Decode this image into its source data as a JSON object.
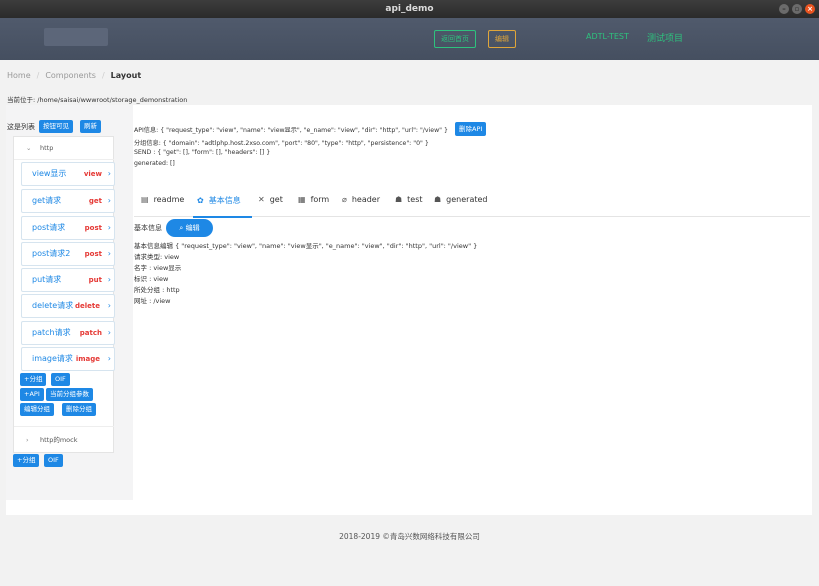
{
  "window": {
    "title": "api_demo",
    "controls": [
      "minimize-icon",
      "maximize-icon",
      "close-icon"
    ]
  },
  "header": {
    "home_button": "返回首页",
    "edit_button": "编辑",
    "links": [
      "ADTL-TEST",
      "测试项目"
    ]
  },
  "breadcrumb": [
    "Home",
    "Components",
    "Layout"
  ],
  "current_path": "当前位于: /home/saisai/wwwroot/storage_demonstration",
  "list": {
    "label": "这是列表",
    "toggle_button": "按钮可见",
    "refresh_button": "刷新"
  },
  "groups": [
    {
      "name": "http",
      "expanded": true,
      "apis": [
        {
          "name": "view显示",
          "method": "view"
        },
        {
          "name": "get请求",
          "method": "get"
        },
        {
          "name": "post请求",
          "method": "post"
        },
        {
          "name": "post请求2",
          "method": "post"
        },
        {
          "name": "put请求",
          "method": "put"
        },
        {
          "name": "delete请求",
          "method": "delete"
        },
        {
          "name": "patch请求",
          "method": "patch"
        },
        {
          "name": "image请求",
          "method": "image"
        }
      ],
      "actions": [
        "+分组",
        "OIF",
        "+API",
        "当前分组参数",
        "编辑分组",
        "删除分组"
      ]
    },
    {
      "name": "http的mock",
      "expanded": false
    }
  ],
  "bottom_actions": [
    "+分组",
    "OIF"
  ],
  "api_info": {
    "api_line": "API信息: { \"request_type\": \"view\", \"name\": \"view显示\", \"e_name\": \"view\", \"dir\": \"http\", \"url\": \"/view\" }",
    "delete_api_button": "删除API",
    "group_line": "分组信息: { \"domain\": \"adtlphp.host.2xso.com\", \"port\": \"80\", \"type\": \"http\", \"persistence\": \"0\" }",
    "send_line": "SEND : { \"get\": [], \"form\": [], \"headers\": [] }",
    "generated_line": "generated: []"
  },
  "tabs": [
    {
      "label": "readme",
      "icon": "document-icon"
    },
    {
      "label": "基本信息",
      "icon": "gear-icon",
      "active": true
    },
    {
      "label": "get",
      "icon": "tools-icon"
    },
    {
      "label": "form",
      "icon": "grid-icon"
    },
    {
      "label": "header",
      "icon": "paperclip-icon"
    },
    {
      "label": "test",
      "icon": "bug-icon"
    },
    {
      "label": "generated",
      "icon": "bug-icon"
    }
  ],
  "basic_info": {
    "label": "基本信息",
    "edit_button": "编辑",
    "lines": [
      "基本信息编辑 { \"request_type\": \"view\", \"name\": \"view显示\", \"e_name\": \"view\", \"dir\": \"http\", \"url\": \"/view\" }",
      "请求类型: view",
      "名字 : view显示",
      "标识 : view",
      "所处分组 : http",
      "网址 : /view"
    ]
  },
  "footer": "2018-2019 ©青岛兴数网络科技有限公司",
  "colors": {
    "accent": "#1e88e5",
    "method": "#e53935",
    "header_bg": "#4a5568",
    "home_button": "#2ec27e",
    "edit_button": "#e0a63a"
  }
}
